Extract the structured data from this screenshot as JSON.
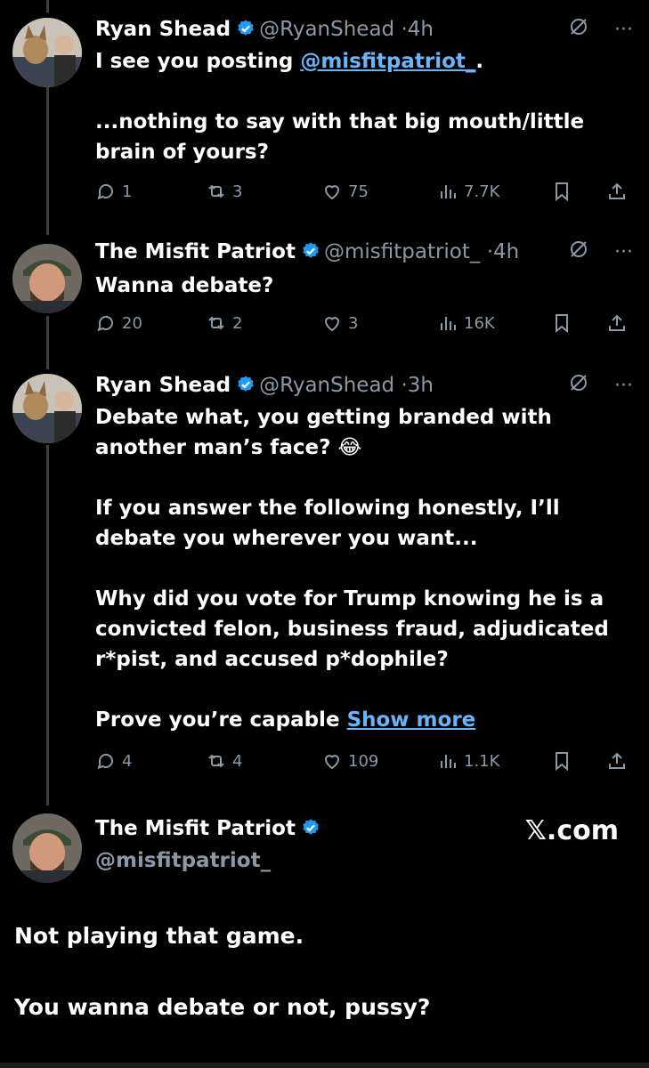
{
  "tweets": [
    {
      "name": "Ryan Shead",
      "handle": "@RyanShead",
      "dot": "·",
      "time": "4h",
      "body": [
        {
          "text": "I see you posting ",
          "mention": "@misfitpatriot_",
          "after": "."
        },
        {
          "text": "...nothing to say with that big mouth/little brain of yours?"
        }
      ],
      "stats": {
        "replies": "1",
        "reposts": "3",
        "likes": "75",
        "views": "7.7K"
      }
    },
    {
      "name": "The Misfit Patriot",
      "handle": "@misfitpatriot_",
      "dot": "·",
      "time": "4h",
      "body": [
        {
          "text": "Wanna debate?"
        }
      ],
      "stats": {
        "replies": "20",
        "reposts": "2",
        "likes": "3",
        "views": "16K"
      }
    },
    {
      "name": "Ryan Shead",
      "handle": "@RyanShead",
      "dot": "·",
      "time": "3h",
      "body": [
        {
          "text": "Debate what, you getting branded with another man’s face? 😂"
        },
        {
          "text": "If you answer the following honestly, I’ll debate you wherever you want..."
        },
        {
          "text": "Why did you vote for Trump knowing he is a convicted felon, business fraud, adjudicated r*pist, and accused p*dophile?"
        },
        {
          "text": "Prove you’re capable ",
          "showmore": "Show more"
        }
      ],
      "stats": {
        "replies": "4",
        "reposts": "4",
        "likes": "109",
        "views": "1.1K"
      }
    }
  ],
  "final": {
    "name": "The Misfit Patriot",
    "handle": "@misfitpatriot_",
    "brand": "𝕏.com",
    "lines": [
      "Not playing that game.",
      "You wanna debate or not, pussy?"
    ]
  },
  "icons": {
    "grok": "grok-icon",
    "more": "more-icon",
    "reply": "reply-icon",
    "repost": "repost-icon",
    "like": "like-icon",
    "views": "views-icon",
    "bookmark": "bookmark-icon",
    "share": "share-icon",
    "verified": "verified-badge-icon"
  },
  "colors": {
    "background": "#000000",
    "text": "#ffffff",
    "muted": "#8b98a5",
    "link": "#6ab4f7",
    "verified": "#1d9bf0"
  }
}
